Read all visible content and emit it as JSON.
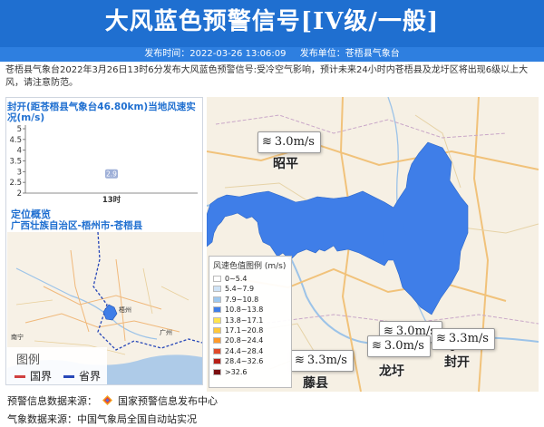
{
  "header": {
    "title": "大风蓝色预警信号[IV级/一般]",
    "publish_time": "发布时间：2022-03-26 13:06:09",
    "publisher": "发布单位：苍梧县气象台"
  },
  "description": "苍梧县气象台2022年3月26日13时6分发布大风蓝色预警信号:受冷空气影响，预计未来24小时内苍梧县及龙圩区将出现6级以上大风，请注意防范。",
  "wind_panel": {
    "title": "封开(距苍梧县气象台46.80km)当地风速实况(m/s)"
  },
  "chart_data": {
    "type": "scatter",
    "title": "封开(距苍梧县气象台46.80km)当地风速实况(m/s)",
    "xlabel": "",
    "ylabel": "",
    "categories": [
      "13时"
    ],
    "series": [
      {
        "values": [
          2.9
        ]
      }
    ],
    "data_labels": [
      "2.9"
    ],
    "yticks": [
      "2",
      "2.5",
      "3",
      "3.5",
      "4",
      "4.5",
      "5"
    ],
    "ylim": [
      2,
      5
    ],
    "grid": false,
    "marker_color": "#9fb0d8"
  },
  "location": {
    "title": "定位概览",
    "path": "广西壮族自治区-梧州市-苍梧县"
  },
  "minimap": {
    "legend_title": "图例",
    "items": [
      {
        "label": "国界",
        "color": "#d04040"
      },
      {
        "label": "省界",
        "color": "#2848b8"
      }
    ],
    "places": [
      "梧州",
      "广州",
      "南宁"
    ]
  },
  "map": {
    "places": [
      "昭平",
      "龙圩",
      "封开",
      "藤县"
    ],
    "wind_readings": [
      "3.0m/s",
      "3.3m/s",
      "3.0m/s",
      "3.0m/s",
      "3.3m/s"
    ],
    "wind_icon": "wind-icon",
    "region_color": "#3f7ee8"
  },
  "legend": {
    "title": "风速色值图例 (m/s)",
    "items": [
      {
        "range": "0~5.4",
        "color": "#ffffff"
      },
      {
        "range": "5.4~7.9",
        "color": "#cfe3f6"
      },
      {
        "range": "7.9~10.8",
        "color": "#9ec8ef"
      },
      {
        "range": "10.8~13.8",
        "color": "#3f7ee8"
      },
      {
        "range": "13.8~17.1",
        "color": "#ffe44d"
      },
      {
        "range": "17.1~20.8",
        "color": "#ffc83a"
      },
      {
        "range": "20.8~24.4",
        "color": "#ff9a2a"
      },
      {
        "range": "24.4~28.4",
        "color": "#e04a2a"
      },
      {
        "range": "28.4~32.6",
        "color": "#b82018"
      },
      {
        "range": ">32.6",
        "color": "#7a0e10"
      }
    ]
  },
  "footer": {
    "warning_source_label": "预警信息数据来源：",
    "warning_source": "国家预警信息发布中心",
    "weather_source": "气象数据来源：中国气象局全国自动站实况"
  }
}
